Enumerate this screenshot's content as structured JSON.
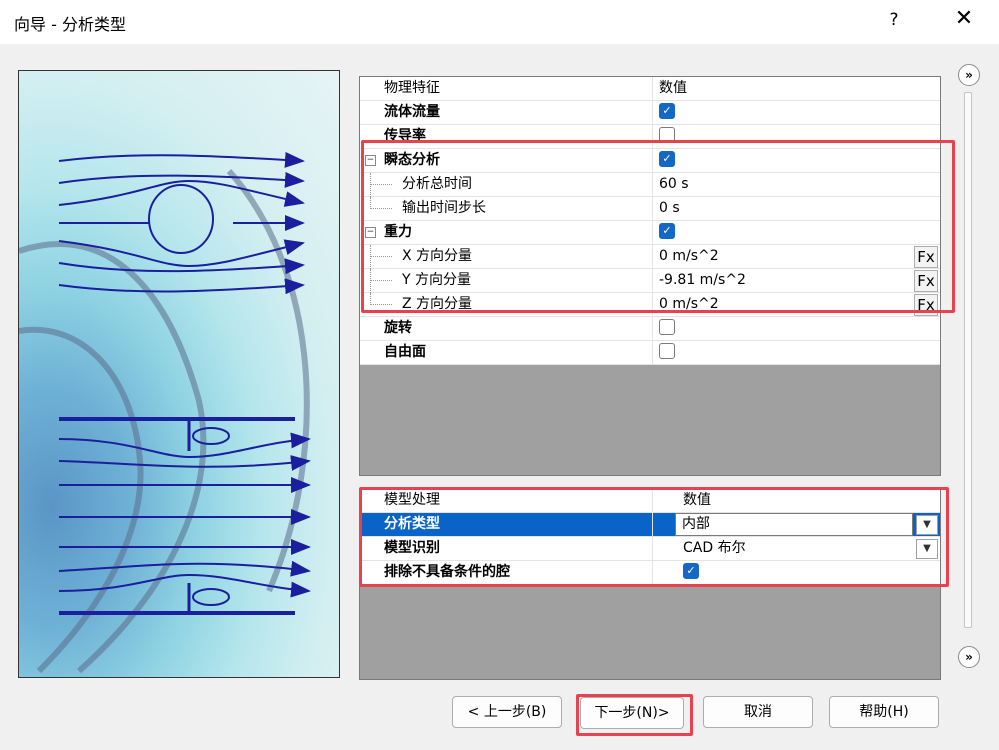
{
  "window": {
    "title": "向导 - 分析类型",
    "help_label": "?",
    "close_label": "✕"
  },
  "physics_grid": {
    "header": {
      "name": "物理特征",
      "value": "数值"
    },
    "rows": [
      {
        "name": "流体流量",
        "checked": true
      },
      {
        "name": "传导率",
        "checked": false
      },
      {
        "name": "瞬态分析",
        "checked": true,
        "expander": "−"
      },
      {
        "name": "分析总时间",
        "value": "60 s"
      },
      {
        "name": "输出时间步长",
        "value": "0 s"
      },
      {
        "name": "重力",
        "checked": true,
        "expander": "−"
      },
      {
        "name": "X 方向分量",
        "value": "0 m/s^2",
        "fx": "Fx"
      },
      {
        "name": "Y 方向分量",
        "value": "-9.81 m/s^2",
        "fx": "Fx"
      },
      {
        "name": "Z 方向分量",
        "value": "0 m/s^2",
        "fx": "Fx"
      },
      {
        "name": "旋转",
        "checked": false
      },
      {
        "name": "自由面",
        "checked": false
      }
    ]
  },
  "model_grid": {
    "header": {
      "name": "模型处理",
      "value": "数值"
    },
    "rows": [
      {
        "name": "分析类型",
        "value": "内部"
      },
      {
        "name": "模型识别",
        "value": "CAD 布尔"
      },
      {
        "name": "排除不具备条件的腔",
        "checked": true
      }
    ]
  },
  "icons": {
    "expand_top": "double-chevron-right-icon",
    "expand_bottom": "double-chevron-right-icon",
    "dropdown": "chevron-down-icon",
    "check": "checkmark-icon"
  },
  "nav_buttons": {
    "back": "< 上一步(B)",
    "next": "下一步(N)>",
    "cancel": "取消",
    "help": "帮助(H)"
  },
  "colors": {
    "highlight_box": "#e8414f",
    "selection": "#0a64c8",
    "checkbox_on": "#1467c4"
  }
}
